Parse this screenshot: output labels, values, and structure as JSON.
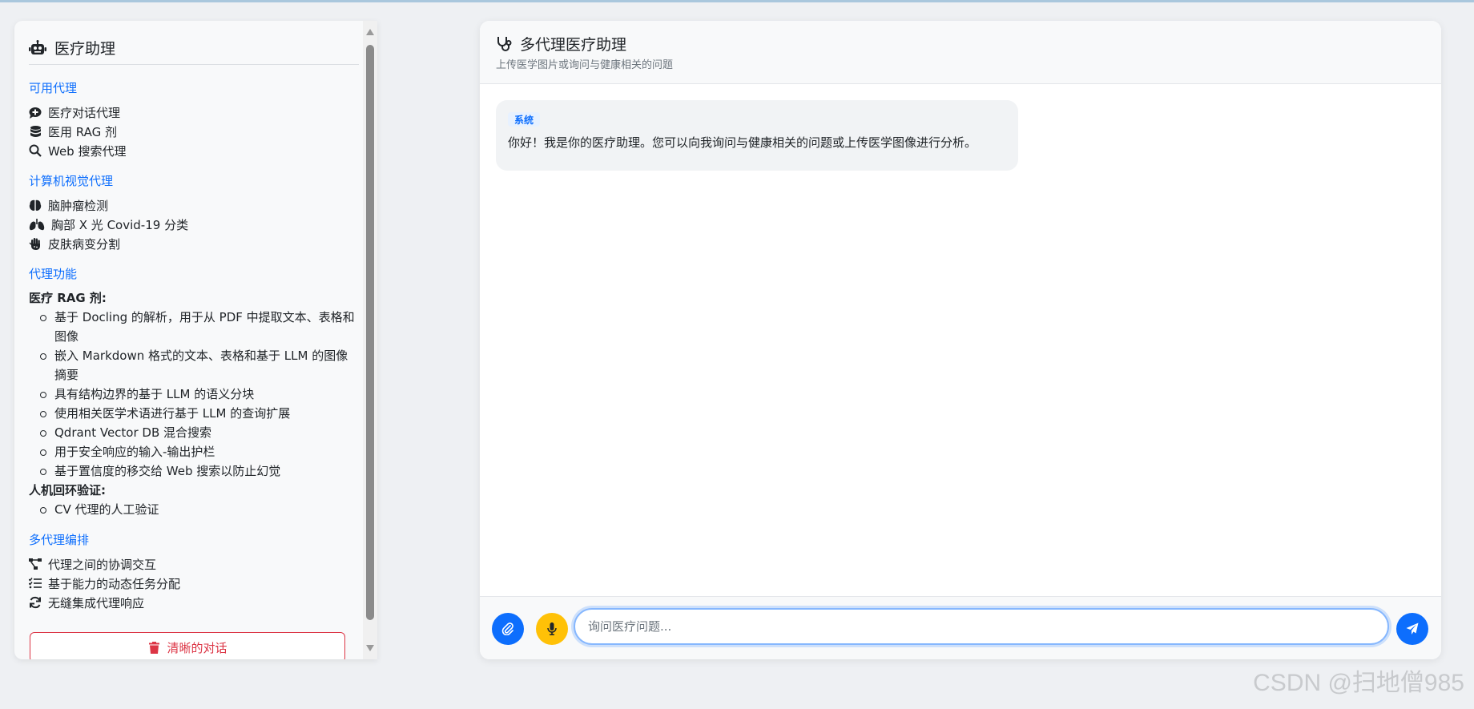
{
  "sidebar": {
    "title": "医疗助理",
    "sections": {
      "available": {
        "heading": "可用代理",
        "items": [
          "医疗对话代理",
          "医用 RAG 剂",
          "Web 搜索代理"
        ]
      },
      "cv": {
        "heading": "计算机视觉代理",
        "items": [
          "脑肿瘤检测",
          "胸部 X 光 Covid-19 分类",
          "皮肤病变分割"
        ]
      },
      "features": {
        "heading": "代理功能",
        "rag_label": "医疗 RAG 剂:",
        "rag_items": [
          "基于 Docling 的解析，用于从 PDF 中提取文本、表格和图像",
          "嵌入 Markdown 格式的文本、表格和基于 LLM 的图像摘要",
          "具有结构边界的基于 LLM 的语义分块",
          "使用相关医学术语进行基于 LLM 的查询扩展",
          "Qdrant Vector DB 混合搜索",
          "用于安全响应的输入-输出护栏",
          "基于置信度的移交给 Web 搜索以防止幻觉"
        ],
        "hitl_label": "人机回环验证:",
        "hitl_items": [
          "CV 代理的人工验证"
        ]
      },
      "orchestration": {
        "heading": "多代理编排",
        "items": [
          "代理之间的协调交互",
          "基于能力的动态任务分配",
          "无缝集成代理响应"
        ]
      }
    },
    "clear_button": "清晰的对话"
  },
  "main": {
    "title": "多代理医疗助理",
    "subtitle": "上传医学图片或询问与健康相关的问题",
    "messages": [
      {
        "role": "系统",
        "text": "你好！我是你的医疗助理。您可以向我询问与健康相关的问题或上传医学图像进行分析。"
      }
    ],
    "input_placeholder": "询问医疗问题..."
  },
  "watermark": "CSDN @扫地僧985",
  "colors": {
    "accent": "#0d6efd",
    "danger": "#dc3545",
    "mic": "#ffc107"
  }
}
